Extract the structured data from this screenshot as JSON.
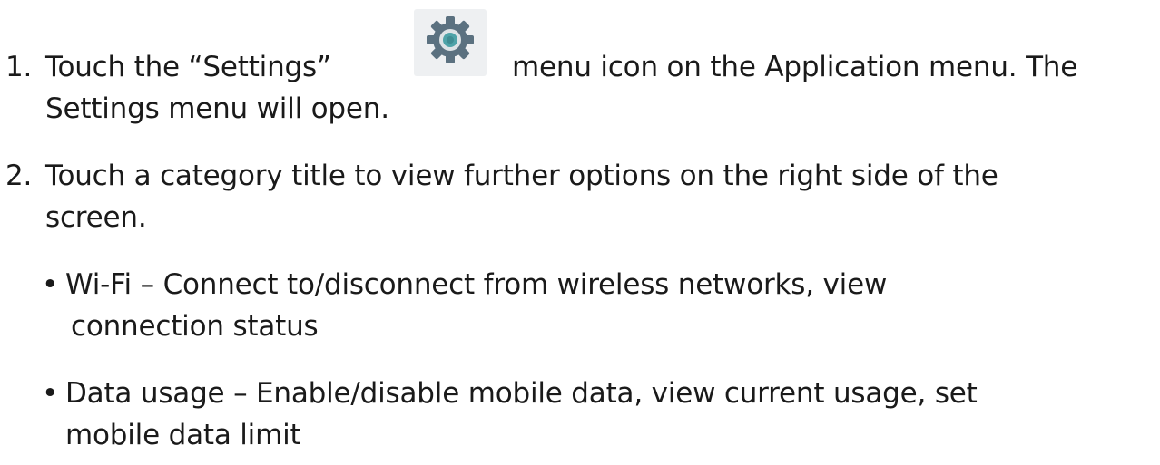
{
  "steps": [
    {
      "number": "1.",
      "line1_before_icon": "Touch the “Settings”",
      "icon": "gear-icon",
      "line1_after_icon": "menu icon on the Application menu. The",
      "line2": "Settings menu will open."
    },
    {
      "number": "2.",
      "line1": "Touch a category title to view further options on the right side of the",
      "line2": "screen."
    }
  ],
  "bullets": [
    {
      "marker": "•",
      "line1": "Wi-Fi – Connect to/disconnect from wireless networks, view",
      "line2": "connection status"
    },
    {
      "marker": "•",
      "line1": "Data usage – Enable/disable mobile data, view current usage, set",
      "line2": "mobile data limit"
    }
  ],
  "colors": {
    "text": "#1a1a1a",
    "icon_gear": "#5b7180",
    "icon_center": "#4ea3a8",
    "icon_background": "#eef0f2"
  }
}
